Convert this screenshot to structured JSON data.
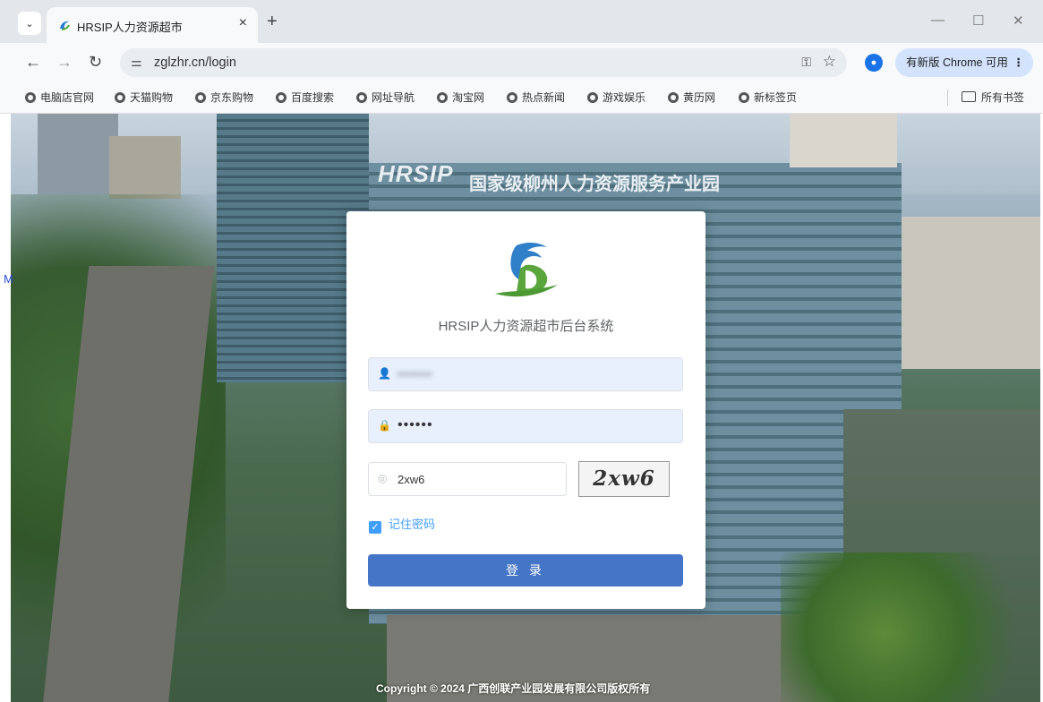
{
  "browser": {
    "tab_title": "HRSIP人力资源超市",
    "tab_close": "×",
    "new_tab": "+",
    "url": "zglzhr.cn/login",
    "update_label": "有新版 Chrome 可用",
    "bookmarks": [
      "电脑店官网",
      "天猫购物",
      "京东购物",
      "百度搜索",
      "网址导航",
      "淘宝网",
      "热点新闻",
      "游戏娱乐",
      "黄历网",
      "新标签页"
    ],
    "all_bookmarks": "所有书签"
  },
  "login": {
    "system_title": "HRSIP人力资源超市后台系统",
    "username_value": "▪▪▪▪▪▪▪",
    "password_value": "••••••",
    "captcha_input_value": "2xw6",
    "captcha_image_text": "2xw6",
    "remember_label": "记住密码",
    "login_button": "登 录"
  },
  "background": {
    "sign_main": "HRSIP",
    "sign_cn": "国家级柳州人力资源服务产业园"
  },
  "footer": {
    "copyright": "Copyright © 2024 广西创联产业园发展有限公司版权所有"
  },
  "colors": {
    "primary": "#4575c7",
    "checkbox": "#409eff",
    "field_bg": "#e8f0fe"
  }
}
